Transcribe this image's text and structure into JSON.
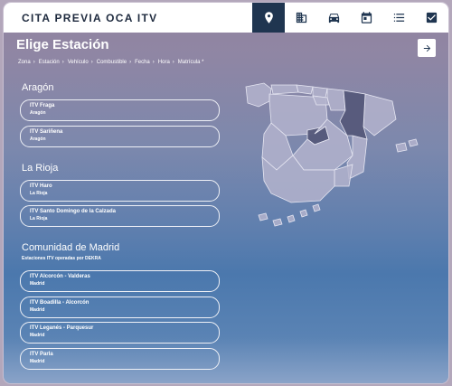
{
  "header": {
    "brand": "CITA PREVIA OCA ITV",
    "nav": [
      {
        "icon": "location-pin-icon",
        "active": true
      },
      {
        "icon": "building-icon",
        "active": false
      },
      {
        "icon": "car-icon",
        "active": false
      },
      {
        "icon": "calendar-icon",
        "active": false
      },
      {
        "icon": "list-icon",
        "active": false
      },
      {
        "icon": "checkbox-icon",
        "active": false
      }
    ]
  },
  "page": {
    "title": "Elige Estación",
    "next_icon": "arrow-right-icon",
    "breadcrumb": [
      "Zona",
      "Estación",
      "Vehículo",
      "Combustible",
      "Fecha",
      "Hora",
      "Matrícula *"
    ]
  },
  "groups": [
    {
      "name": "Aragón",
      "subtitle": "",
      "stations": [
        {
          "name": "ITV Fraga",
          "region": "Aragón"
        },
        {
          "name": "ITV Sariñena",
          "region": "Aragón"
        }
      ]
    },
    {
      "name": "La Rioja",
      "subtitle": "",
      "stations": [
        {
          "name": "ITV Haro",
          "region": "La Rioja"
        },
        {
          "name": "ITV Santo Domingo de la Calzada",
          "region": "La Rioja"
        }
      ]
    },
    {
      "name": "Comunidad de Madrid",
      "subtitle": "Estaciones ITV operadas por DEKRA",
      "stations": [
        {
          "name": "ITV Alcorcón - Valderas",
          "region": "Madrid"
        },
        {
          "name": "ITV Boadilla - Alcorcón",
          "region": "Madrid"
        },
        {
          "name": "ITV Leganés - Parquesur",
          "region": "Madrid"
        },
        {
          "name": "ITV Parla",
          "region": "Madrid"
        }
      ]
    }
  ],
  "colors": {
    "header_bg": "#ffffff",
    "nav_active": "#1f3550",
    "map_fill": "#b3b3cc",
    "map_highlight": "#55597a"
  }
}
